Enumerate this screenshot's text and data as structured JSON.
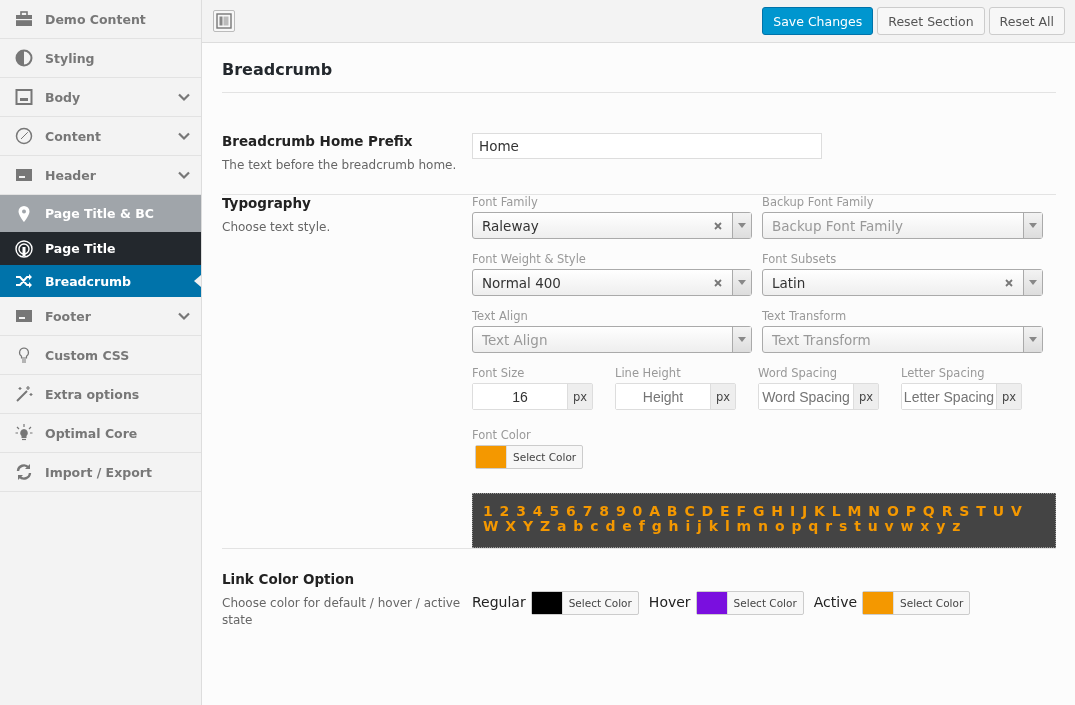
{
  "sidebar": {
    "items": [
      {
        "label": "Demo Content",
        "selected": false,
        "collapsed": false
      },
      {
        "label": "Styling",
        "selected": false,
        "collapsed": false
      },
      {
        "label": "Body",
        "selected": false,
        "collapsed": true
      },
      {
        "label": "Content",
        "selected": false,
        "collapsed": true
      },
      {
        "label": "Header",
        "selected": false,
        "collapsed": true
      },
      {
        "label": "Page Title & BC",
        "selected": false,
        "collapsed": false,
        "expanded": true,
        "children": [
          {
            "label": "Page Title",
            "selected": false
          },
          {
            "label": "Breadcrumb",
            "selected": true
          }
        ]
      },
      {
        "label": "Footer",
        "selected": false,
        "collapsed": true
      },
      {
        "label": "Custom CSS",
        "selected": false,
        "collapsed": false
      },
      {
        "label": "Extra options",
        "selected": false,
        "collapsed": false
      },
      {
        "label": "Optimal Core",
        "selected": false,
        "collapsed": false
      },
      {
        "label": "Import / Export",
        "selected": false,
        "collapsed": false
      }
    ]
  },
  "toolbar": {
    "buttons": [
      {
        "label": "Save Changes",
        "kind": "primary"
      },
      {
        "label": "Reset Section",
        "kind": "secondary"
      },
      {
        "label": "Reset All",
        "kind": "secondary"
      }
    ]
  },
  "section": {
    "title": "Breadcrumb",
    "fields": [
      {
        "kind": "text",
        "title": "Breadcrumb Home Prefix",
        "description": "The text before the breadcrumb home.",
        "value": "Home"
      },
      {
        "kind": "typography",
        "title": "Typography",
        "description": "Choose text style.",
        "selects": [
          {
            "label": "Font Family",
            "value": "Raleway",
            "clearable": true
          },
          {
            "label": "Backup Font Family",
            "placeholder": "Backup Font Family",
            "clearable": false
          },
          {
            "label": "Font Weight & Style",
            "value": "Normal 400",
            "clearable": true
          },
          {
            "label": "Font Subsets",
            "value": "Latin",
            "clearable": true
          },
          {
            "label": "Text Align",
            "placeholder": "Text Align",
            "clearable": false
          },
          {
            "label": "Text Transform",
            "placeholder": "Text Transform",
            "clearable": false
          }
        ],
        "numbers": [
          {
            "label": "Font Size",
            "value": "16",
            "unit": "px"
          },
          {
            "label": "Line Height",
            "placeholder": "Height",
            "unit": "px"
          },
          {
            "label": "Word Spacing",
            "placeholder": "Word Spacing",
            "unit": "px"
          },
          {
            "label": "Letter Spacing",
            "placeholder": "Letter Spacing",
            "unit": "px"
          }
        ],
        "font_color": {
          "label": "Font Color",
          "color": "#f49800",
          "button": "Select Color"
        },
        "preview": {
          "text": "1 2 3 4 5 6 7 8 9 0 A B C D E F G H I J K L M N O P Q R S T U V W X Y Z a b c d e f g h i j k l m n o p q r s t u v w x y z",
          "color": "#f49800"
        }
      },
      {
        "kind": "colors",
        "title": "Link Color Option",
        "description": "Choose color for default / hover / active state",
        "pickers": [
          {
            "label": "Regular",
            "color": "#000000",
            "button": "Select Color"
          },
          {
            "label": "Hover",
            "color": "#7a0fdf",
            "button": "Select Color"
          },
          {
            "label": "Active",
            "color": "#f49800",
            "button": "Select Color"
          }
        ]
      }
    ]
  }
}
